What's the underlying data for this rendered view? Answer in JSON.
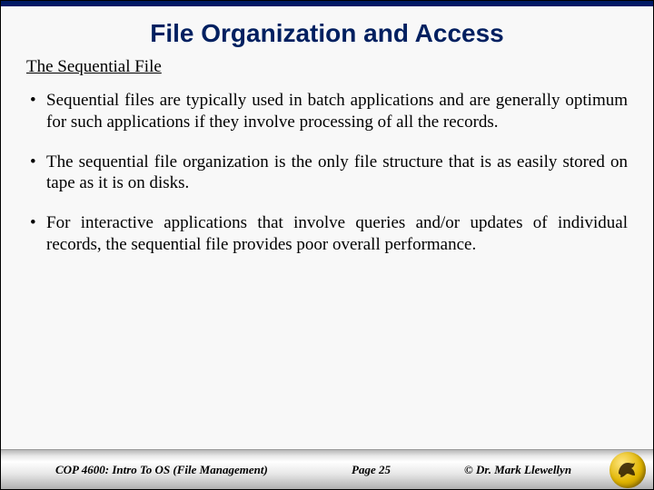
{
  "title": "File Organization and Access",
  "subheading": "The Sequential File",
  "bullets": [
    "Sequential files are typically used in batch applications and are generally optimum for such applications if they involve processing of all the records.",
    "The sequential file organization is the only file structure that is as easily stored on tape as it is on disks.",
    "For interactive applications that involve queries and/or updates of individual records, the sequential file provides poor overall performance."
  ],
  "footer": {
    "course": "COP 4600: Intro To OS  (File Management)",
    "page": "Page 25",
    "author": "© Dr. Mark Llewellyn"
  }
}
